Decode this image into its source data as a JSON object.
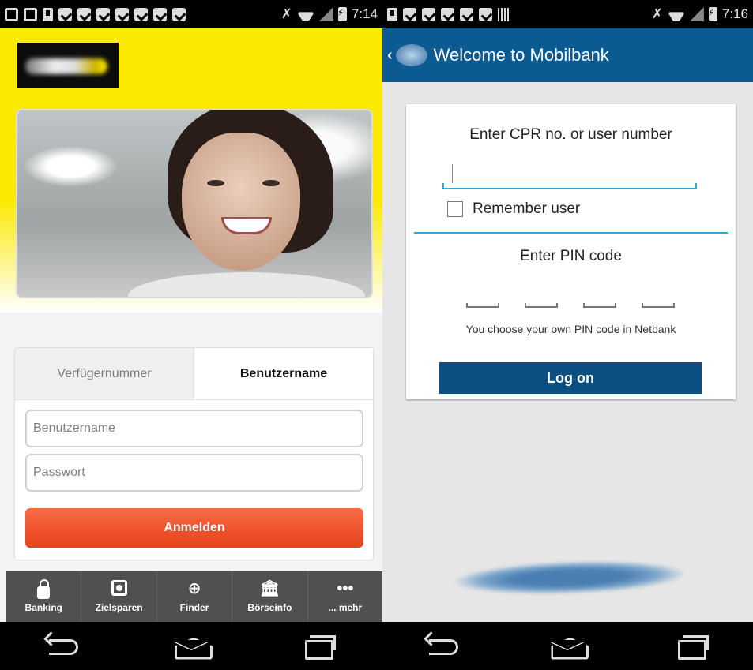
{
  "left_phone": {
    "status_bar": {
      "time": "7:14"
    },
    "tabs": [
      {
        "label": "Verfügernummer"
      },
      {
        "label": "Benutzername"
      }
    ],
    "form": {
      "username_placeholder": "Benutzername",
      "password_placeholder": "Passwort",
      "submit_label": "Anmelden"
    },
    "tabbar": [
      {
        "label": "Banking",
        "icon": "lock-icon"
      },
      {
        "label": "Zielsparen",
        "icon": "safe-icon"
      },
      {
        "label": "Finder",
        "icon": "crosshair-icon"
      },
      {
        "label": "Börseinfo",
        "icon": "bank-icon"
      },
      {
        "label": "... mehr",
        "icon": "more-icon"
      }
    ],
    "colors": {
      "header": "#fbe900",
      "button": "#e8421c",
      "tabbar": "#505050"
    }
  },
  "right_phone": {
    "status_bar": {
      "time": "7:16"
    },
    "header": {
      "title": "Welcome to Mobilbank"
    },
    "card": {
      "user_label": "Enter CPR no. or user number",
      "remember_label": "Remember user",
      "pin_label": "Enter PIN code",
      "pin_hint": "You choose your own PIN code in Netbank",
      "logon_label": "Log on"
    },
    "colors": {
      "header": "#0c5a92",
      "button": "#0c4f82",
      "accent": "#37a6d6"
    }
  }
}
